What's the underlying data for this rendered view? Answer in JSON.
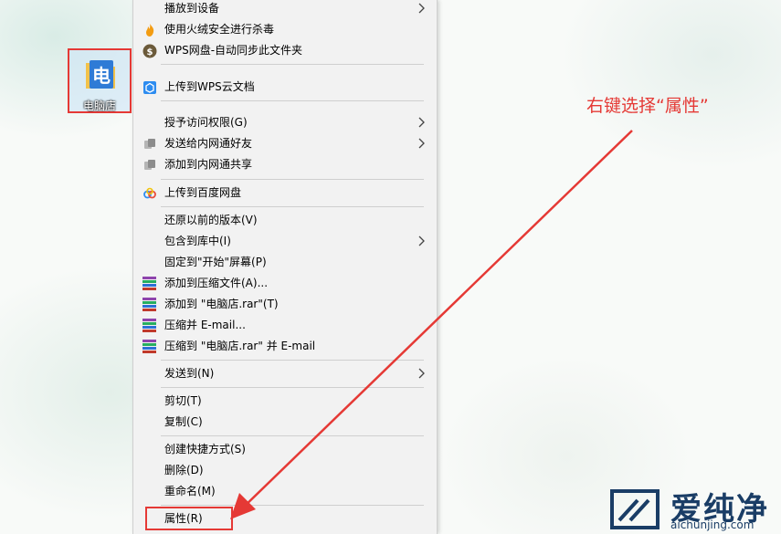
{
  "desktop": {
    "icon_label": "电脑店",
    "icon_glyph": "电"
  },
  "menu": {
    "items": [
      {
        "label": "播放到设备",
        "icon": "none",
        "submenu": true
      },
      {
        "label": "使用火绒安全进行杀毒",
        "icon": "flame-icon",
        "submenu": false
      },
      {
        "label": "WPS网盘-自动同步此文件夹",
        "icon": "wps-drive-icon",
        "submenu": false
      },
      {
        "label": "上传到WPS云文档",
        "icon": "wps-cloud-icon",
        "submenu": false
      },
      {
        "label": "授予访问权限(G)",
        "icon": "none",
        "submenu": true
      },
      {
        "label": "发送给内网通好友",
        "icon": "lan-share-icon",
        "submenu": true
      },
      {
        "label": "添加到内网通共享",
        "icon": "lan-share-icon",
        "submenu": false
      },
      {
        "label": "上传到百度网盘",
        "icon": "baidu-cloud-icon",
        "submenu": false
      },
      {
        "label": "还原以前的版本(V)",
        "icon": "none",
        "submenu": false
      },
      {
        "label": "包含到库中(I)",
        "icon": "none",
        "submenu": true
      },
      {
        "label": "固定到\"开始\"屏幕(P)",
        "icon": "none",
        "submenu": false
      },
      {
        "label": "添加到压缩文件(A)...",
        "icon": "winrar-icon",
        "submenu": false
      },
      {
        "label": "添加到 \"电脑店.rar\"(T)",
        "icon": "winrar-icon",
        "submenu": false
      },
      {
        "label": "压缩并 E-mail...",
        "icon": "winrar-icon",
        "submenu": false
      },
      {
        "label": "压缩到 \"电脑店.rar\" 并 E-mail",
        "icon": "winrar-icon",
        "submenu": false
      },
      {
        "label": "发送到(N)",
        "icon": "none",
        "submenu": true
      },
      {
        "label": "剪切(T)",
        "icon": "none",
        "submenu": false
      },
      {
        "label": "复制(C)",
        "icon": "none",
        "submenu": false
      },
      {
        "label": "创建快捷方式(S)",
        "icon": "none",
        "submenu": false
      },
      {
        "label": "删除(D)",
        "icon": "none",
        "submenu": false
      },
      {
        "label": "重命名(M)",
        "icon": "none",
        "submenu": false
      },
      {
        "label": "属性(R)",
        "icon": "none",
        "submenu": false
      }
    ]
  },
  "annotation": {
    "text": "右键选择“属性”",
    "color": "#e53935"
  },
  "watermark": {
    "cn": "爱纯净",
    "en": "aichunjing.com"
  }
}
